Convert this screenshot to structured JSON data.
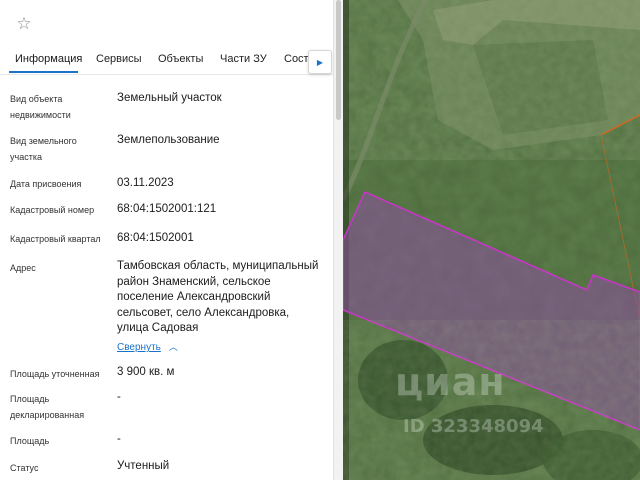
{
  "panel": {
    "favorite_icon": "star-icon",
    "tabs": [
      {
        "label": "Информация",
        "active": true
      },
      {
        "label": "Сервисы",
        "active": false
      },
      {
        "label": "Объекты",
        "active": false
      },
      {
        "label": "Части ЗУ",
        "active": false
      },
      {
        "label": "Состав",
        "active": false
      }
    ],
    "tabs_next_icon": "arrow-right-icon",
    "rows": [
      {
        "label": "Вид объекта недвижимости",
        "value": "Земельный участок"
      },
      {
        "label": "Вид земельного участка",
        "value": "Землепользование"
      },
      {
        "label": "Дата присвоения",
        "value": "03.11.2023"
      },
      {
        "label": "Кадастровый номер",
        "value": "68:04:1502001:121"
      },
      {
        "label": "Кадастровый квартал",
        "value": "68:04:1502001"
      },
      {
        "label": "Адрес",
        "value": "Тамбовская область, муниципальный район Знаменский, сельское поселение Александровский сельсовет, село Александровка, улица Садовая"
      },
      {
        "label": "Площадь уточненная",
        "value": "3 900 кв. м"
      },
      {
        "label": "Площадь декларированная",
        "value": "-"
      },
      {
        "label": "Площадь",
        "value": "-"
      },
      {
        "label": "Статус",
        "value": "Учтенный"
      }
    ],
    "address_collapse": {
      "label": "Свернуть",
      "icon": "chevron-up-icon"
    }
  },
  "map": {
    "watermark_logo": "циан",
    "watermark_id": "ID 323348094",
    "colors": {
      "parcel_fill": "#8c4fa0",
      "parcel_stroke": "#cc33cc",
      "neighbor_stroke": "#d2691e",
      "vegetation": "#3f5f30"
    }
  }
}
